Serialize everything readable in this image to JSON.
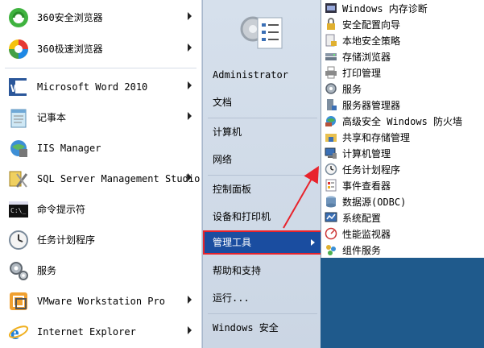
{
  "left_programs": [
    {
      "label": "360安全浏览器",
      "icon": "360-browser-icon",
      "arrow": true
    },
    {
      "label": "360极速浏览器",
      "icon": "360-chrome-icon",
      "arrow": true
    },
    {
      "label": "Microsoft Word 2010",
      "icon": "word-icon",
      "arrow": true
    },
    {
      "label": "记事本",
      "icon": "notepad-icon",
      "arrow": true
    },
    {
      "label": "IIS Manager",
      "icon": "iis-icon",
      "arrow": false
    },
    {
      "label": "SQL Server Management Studio",
      "icon": "sql-server-icon",
      "arrow": true
    },
    {
      "label": "命令提示符",
      "icon": "cmd-icon",
      "arrow": false
    },
    {
      "label": "任务计划程序",
      "icon": "clock-icon",
      "arrow": false
    },
    {
      "label": "服务",
      "icon": "gears-icon",
      "arrow": false
    },
    {
      "label": "VMware Workstation Pro",
      "icon": "vmware-icon",
      "arrow": true
    },
    {
      "label": "Internet Explorer",
      "icon": "ie-icon",
      "arrow": true
    }
  ],
  "middle": {
    "user": "Administrator",
    "items": [
      "文档",
      "计算机",
      "网络",
      "控制面板",
      "设备和打印机",
      "管理工具",
      "帮助和支持",
      "运行...",
      "Windows 安全"
    ],
    "highlighted": "管理工具"
  },
  "submenu": [
    {
      "label": "Windows 内存诊断",
      "icon": "memory-icon"
    },
    {
      "label": "安全配置向导",
      "icon": "lock-icon"
    },
    {
      "label": "本地安全策略",
      "icon": "lock-doc-icon"
    },
    {
      "label": "存储浏览器",
      "icon": "storage-icon"
    },
    {
      "label": "打印管理",
      "icon": "printer-icon"
    },
    {
      "label": "服务",
      "icon": "gear-icon"
    },
    {
      "label": "服务器管理器",
      "icon": "server-icon"
    },
    {
      "label": "高级安全 Windows 防火墙",
      "icon": "firewall-icon"
    },
    {
      "label": "共享和存储管理",
      "icon": "share-icon"
    },
    {
      "label": "计算机管理",
      "icon": "computer-icon"
    },
    {
      "label": "任务计划程序",
      "icon": "clock-icon"
    },
    {
      "label": "事件查看器",
      "icon": "event-icon"
    },
    {
      "label": "数据源(ODBC)",
      "icon": "odbc-icon"
    },
    {
      "label": "系统配置",
      "icon": "sysconfig-icon"
    },
    {
      "label": "性能监视器",
      "icon": "perf-icon"
    },
    {
      "label": "组件服务",
      "icon": "component-icon"
    }
  ],
  "colors": {
    "highlight": "#1a4da0",
    "annotation": "#e8232c"
  }
}
